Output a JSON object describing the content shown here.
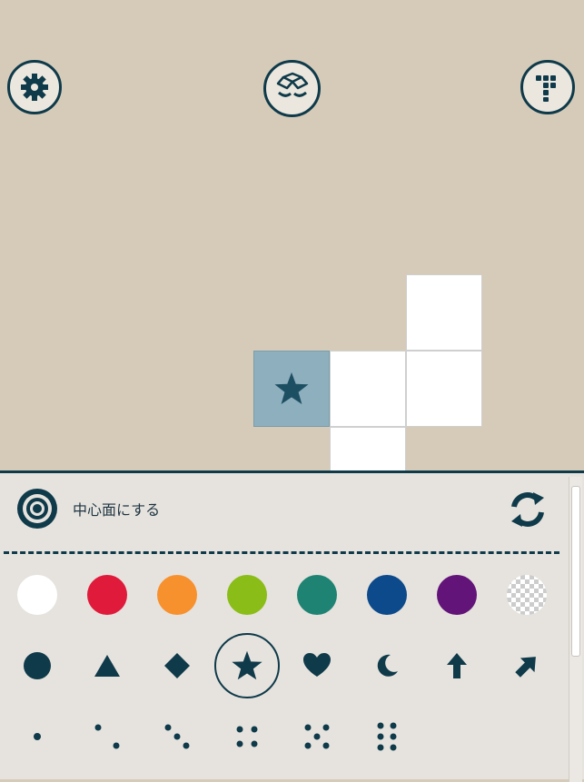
{
  "toolbar": {
    "settings_icon": "gear-icon",
    "cube_icon": "open-box-eyes-icon",
    "pieces_icon": "tetromino-icon"
  },
  "panel": {
    "center_face_label": "中心面にする",
    "refresh_icon": "refresh-icon",
    "colors": [
      {
        "name": "white",
        "hex": "#ffffff"
      },
      {
        "name": "red",
        "hex": "#e01a3b"
      },
      {
        "name": "orange",
        "hex": "#f7912e"
      },
      {
        "name": "green",
        "hex": "#8bbd18"
      },
      {
        "name": "teal",
        "hex": "#1f8374"
      },
      {
        "name": "blue",
        "hex": "#0c4a8b"
      },
      {
        "name": "purple",
        "hex": "#621479"
      },
      {
        "name": "transparent",
        "hex": "transparent"
      }
    ],
    "shapes": [
      "circle",
      "triangle",
      "diamond",
      "star",
      "heart",
      "crescent",
      "up-arrow",
      "diagonal-arrow"
    ],
    "selected_shape": "star",
    "dice": [
      1,
      2,
      3,
      4,
      5,
      6
    ]
  },
  "theme": {
    "accent": "#0f3a4a",
    "background": "#d6cbb9",
    "panel": "#e6e3de",
    "selected_face": "#8eafbd"
  }
}
